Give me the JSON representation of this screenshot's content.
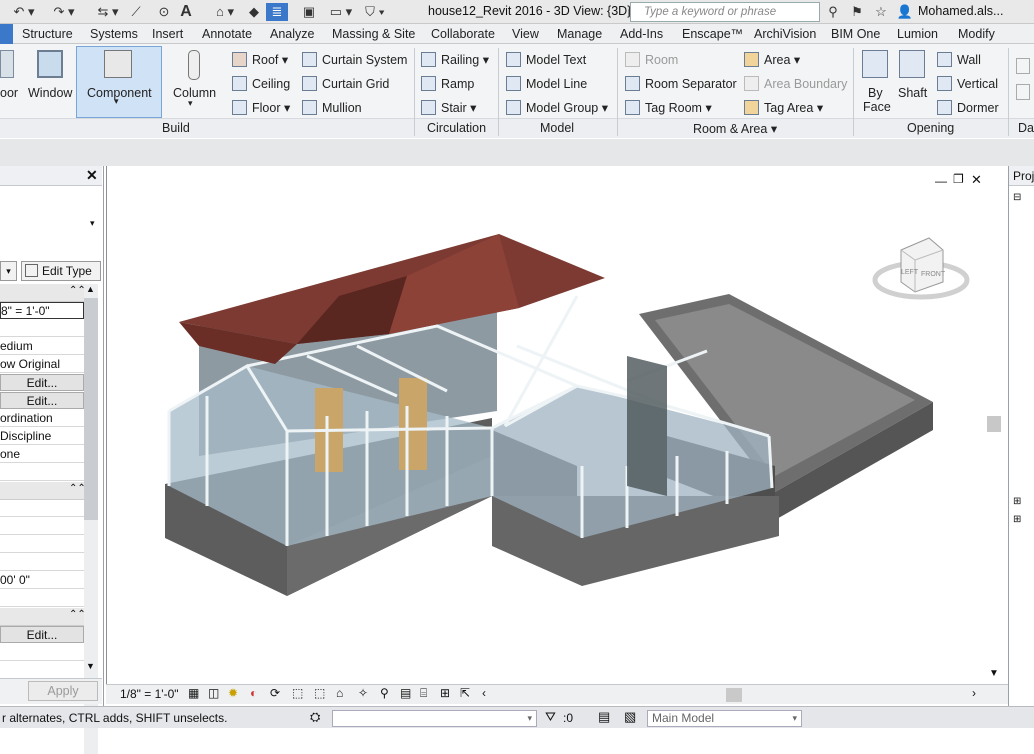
{
  "title_bar": {
    "document_title": "house12_Revit 2016 - 3D View: {3D}",
    "search_placeholder": "Type a keyword or phrase",
    "user_name": "Mohamed.als..."
  },
  "tabs": [
    "Structure",
    "Systems",
    "Insert",
    "Annotate",
    "Analyze",
    "Massing & Site",
    "Collaborate",
    "View",
    "Manage",
    "Add-Ins",
    "Enscape™",
    "ArchiVision",
    "BIM One",
    "Lumion",
    "Modify"
  ],
  "ribbon": {
    "build": {
      "label": "Build",
      "door": "oor",
      "window": "Window",
      "component": "Component",
      "column": "Column",
      "roof": "Roof",
      "ceiling": "Ceiling",
      "floor": "Floor",
      "curtain_system": "Curtain System",
      "curtain_grid": "Curtain Grid",
      "mullion": "Mullion"
    },
    "circulation": {
      "label": "Circulation",
      "railing": "Railing",
      "ramp": "Ramp",
      "stair": "Stair"
    },
    "model": {
      "label": "Model",
      "model_text": "Model Text",
      "model_line": "Model Line",
      "model_group": "Model Group"
    },
    "room_area": {
      "label": "Room & Area",
      "room": "Room",
      "room_separator": "Room Separator",
      "tag_room": "Tag Room",
      "area": "Area",
      "area_boundary": "Area Boundary",
      "tag_area": "Tag Area"
    },
    "opening": {
      "label": "Opening",
      "by_face_1": "By",
      "by_face_2": "Face",
      "shaft": "Shaft",
      "wall": "Wall",
      "vertical": "Vertical",
      "dormer": "Dormer"
    },
    "datum_partial": "Da"
  },
  "properties": {
    "edit_type": "Edit Type",
    "rows": [
      "8\" = 1'-0\"",
      "edium",
      "ow Original",
      "Edit...",
      "Edit...",
      "ordination",
      " Discipline",
      "one"
    ],
    "extent_value": "00'  0\"",
    "edit_bottom": "Edit...",
    "apply": "Apply"
  },
  "project_browser": {
    "title": "Proj"
  },
  "viewcube": {
    "left": "LEFT",
    "front": "FRONT"
  },
  "view_control": {
    "scale": "1/8\" = 1'-0\""
  },
  "status": {
    "message": "r alternates, CTRL adds, SHIFT unselects.",
    "filter_count": ":0",
    "model": "Main Model"
  },
  "colors": {
    "roof": "#7c3a32",
    "base": "#6f6f6f",
    "glass": "#9fb6c4",
    "mullion": "#e8eef2",
    "door": "#c9a56a",
    "deck": "#8c8c8c"
  }
}
